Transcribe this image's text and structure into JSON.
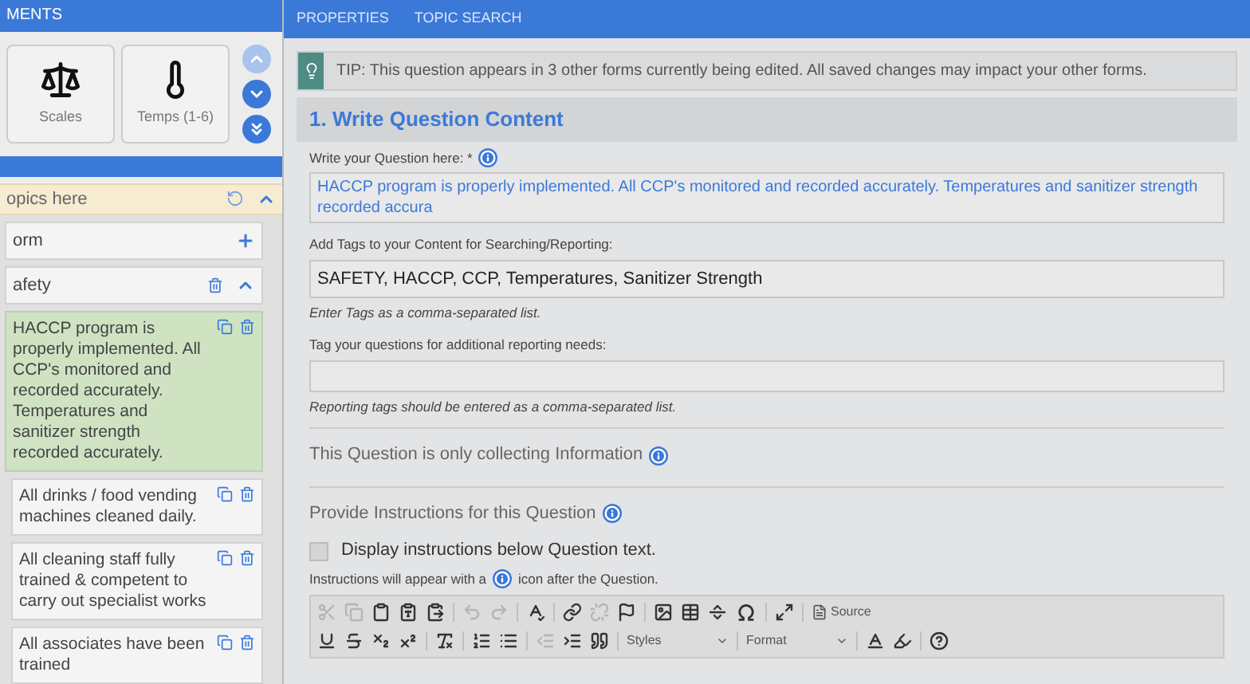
{
  "sidebar": {
    "title": "MENTS",
    "tools": [
      {
        "label": "Scales",
        "kind": "scales"
      },
      {
        "label": "Temps (1-6)",
        "kind": "thermometer"
      }
    ],
    "scroll_buttons": [
      {
        "kind": "up",
        "disabled": true
      },
      {
        "kind": "down",
        "disabled": false
      },
      {
        "kind": "bottom",
        "disabled": false
      }
    ],
    "drop_zone": {
      "label": "opics here"
    },
    "form_row": {
      "label": "orm"
    },
    "section_row": {
      "label": "afety",
      "expanded": true
    },
    "topics": [
      {
        "text": "HACCP program is properly implemented. All CCP's monitored and recorded accurately. Temperatures and sanitizer strength recorded accurately.",
        "selected": true
      },
      {
        "text": "All drinks / food vending machines cleaned daily.",
        "selected": false
      },
      {
        "text": "All cleaning staff fully trained & competent to carry out specialist works",
        "selected": false
      },
      {
        "text": "All associates have been trained",
        "selected": false
      }
    ]
  },
  "tabs": [
    {
      "label": "PROPERTIES",
      "selected": false
    },
    {
      "label": "TOPIC SEARCH",
      "selected": false
    }
  ],
  "tip": "TIP: This question appears in 3 other forms currently being edited. All saved changes may impact your other forms.",
  "section_title": "1. Write Question Content",
  "question": {
    "label": "Write your Question here: *",
    "value": "HACCP program is properly implemented. All CCP's monitored and recorded accurately. Temperatures and sanitizer strength recorded accura"
  },
  "tags": {
    "label": "Add Tags to your Content for Searching/Reporting:",
    "value": "SAFETY, HACCP, CCP, Temperatures, Sanitizer Strength",
    "hint": "Enter Tags as a comma-separated list."
  },
  "reporting_tags": {
    "label": "Tag your questions for additional reporting needs:",
    "hint": "Reporting tags should be entered as a comma-separated list."
  },
  "info_only": {
    "label": "This Question is only collecting Information"
  },
  "instructions": {
    "label": "Provide Instructions for this Question",
    "checkbox_label": "Display instructions below Question text.",
    "checked": false,
    "hint_before": "Instructions will appear with a",
    "hint_after": "icon after the Question."
  },
  "toolbar_rows": [
    [
      {
        "kind": "cut",
        "disabled": true
      },
      {
        "kind": "copy",
        "disabled": true
      },
      {
        "kind": "paste",
        "disabled": false
      },
      {
        "kind": "paste-text",
        "disabled": false
      },
      {
        "kind": "paste-word",
        "disabled": false
      },
      {
        "kind": "sep"
      },
      {
        "kind": "undo",
        "disabled": true
      },
      {
        "kind": "redo",
        "disabled": true
      },
      {
        "kind": "sep"
      },
      {
        "kind": "spellcheck",
        "disabled": false
      },
      {
        "kind": "sep"
      },
      {
        "kind": "link",
        "disabled": false
      },
      {
        "kind": "unlink",
        "disabled": true
      },
      {
        "kind": "flag",
        "disabled": false
      },
      {
        "kind": "sep"
      },
      {
        "kind": "image",
        "disabled": false
      },
      {
        "kind": "table",
        "disabled": false
      },
      {
        "kind": "rule",
        "disabled": false
      },
      {
        "kind": "omega",
        "disabled": false
      },
      {
        "kind": "sep"
      },
      {
        "kind": "maximize",
        "disabled": false
      },
      {
        "kind": "sep"
      },
      {
        "kind": "source",
        "label": "Source"
      }
    ],
    [
      {
        "kind": "underline",
        "disabled": false
      },
      {
        "kind": "strike",
        "disabled": false
      },
      {
        "kind": "subscript",
        "disabled": false
      },
      {
        "kind": "superscript",
        "disabled": false
      },
      {
        "kind": "sep"
      },
      {
        "kind": "clear-format",
        "disabled": false
      },
      {
        "kind": "sep"
      },
      {
        "kind": "ordered-list",
        "disabled": false
      },
      {
        "kind": "bullet-list",
        "disabled": false
      },
      {
        "kind": "sep"
      },
      {
        "kind": "outdent",
        "disabled": true
      },
      {
        "kind": "indent",
        "disabled": false
      },
      {
        "kind": "quote",
        "disabled": false
      },
      {
        "kind": "sep"
      },
      {
        "kind": "dropdown",
        "label": "Styles"
      },
      {
        "kind": "sep"
      },
      {
        "kind": "dropdown",
        "label": "Format"
      },
      {
        "kind": "sep"
      },
      {
        "kind": "text-color",
        "disabled": false
      },
      {
        "kind": "bg-color",
        "disabled": false
      },
      {
        "kind": "sep"
      },
      {
        "kind": "help",
        "disabled": false
      }
    ]
  ]
}
